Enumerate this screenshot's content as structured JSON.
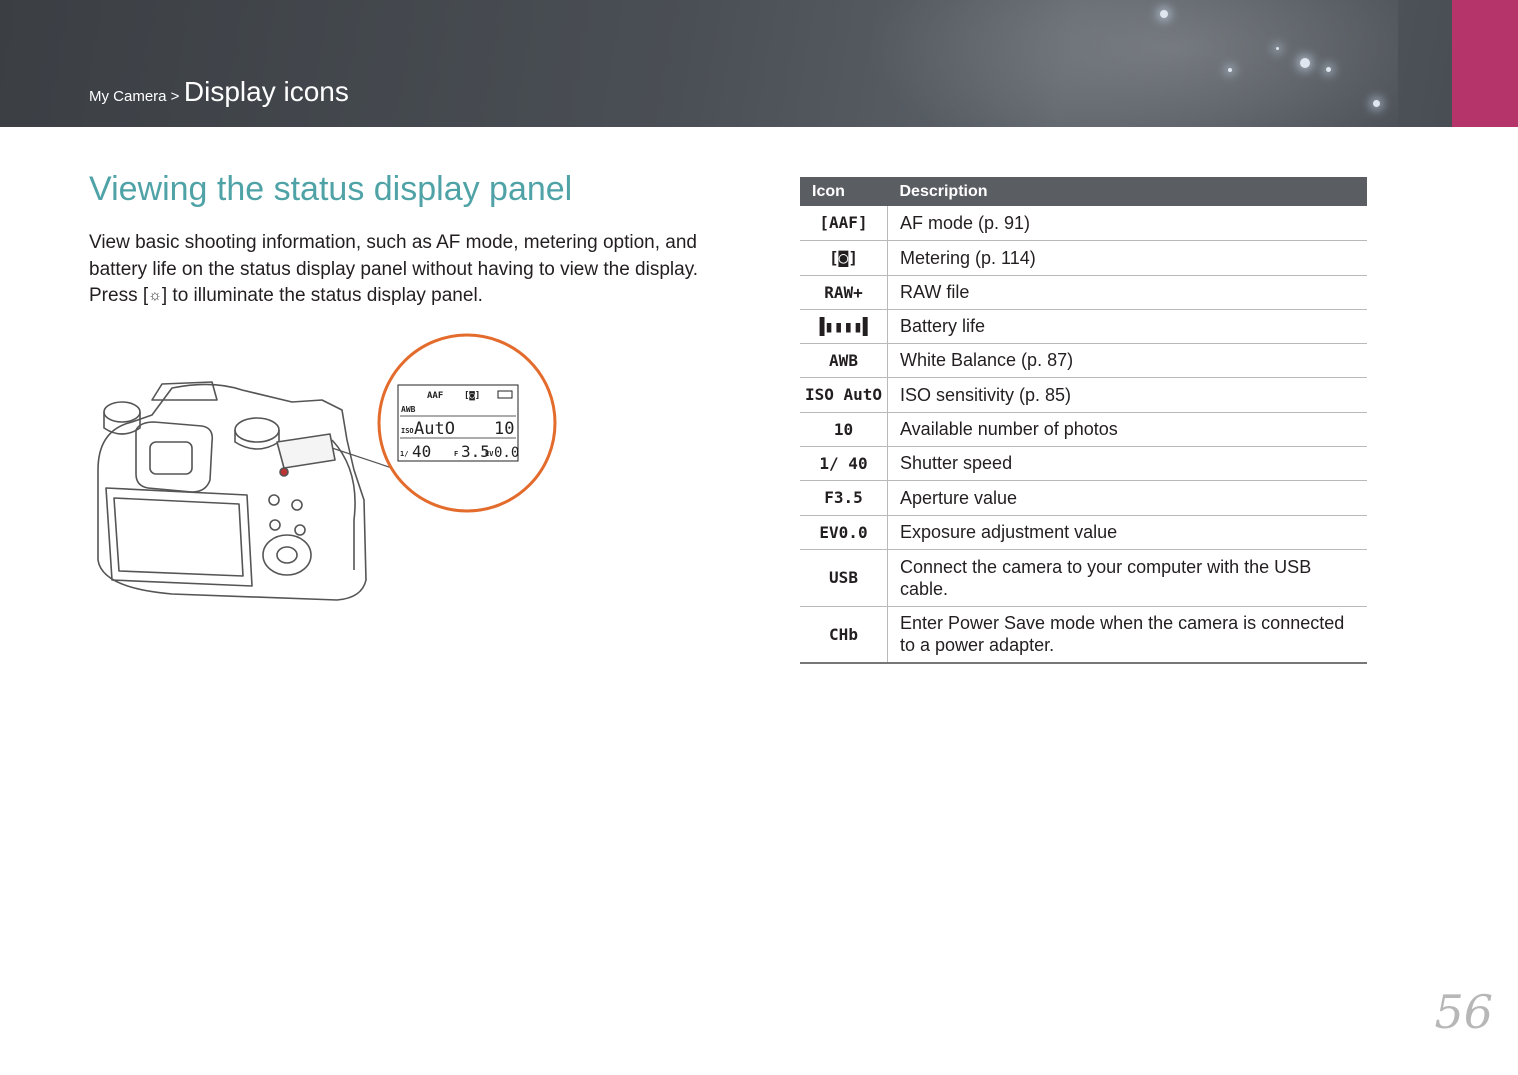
{
  "header": {
    "breadcrumb_parent": "My Camera >",
    "breadcrumb_current": "Display icons"
  },
  "section": {
    "title": "Viewing the status display panel",
    "intro_line1": "View basic shooting information, such as AF mode, metering option, and",
    "intro_line2": "battery life on the status display panel without having to view the display.",
    "intro_press": "Press [",
    "intro_after": "] to illuminate the status display panel."
  },
  "lcd": {
    "af": "AAF",
    "wb": "AWB",
    "iso_label": "ISO",
    "iso_value": "AutO",
    "shots": "10",
    "shutter_prefix": "1/",
    "shutter": "40",
    "aperture_prefix": "F",
    "aperture": "3.5",
    "ev_prefix": "EV",
    "ev": "0.0"
  },
  "table": {
    "col_icon": "Icon",
    "col_desc": "Description",
    "rows": [
      {
        "icon": "[AAF]",
        "icon_name": "af-mode-icon",
        "desc": "AF mode (p. 91)"
      },
      {
        "icon": "[◙]",
        "icon_name": "metering-icon",
        "desc": "Metering (p. 114)"
      },
      {
        "icon": "RAW+",
        "icon_name": "raw-plus-icon",
        "desc": "RAW file"
      },
      {
        "icon": "▐▮▮▮▮▌",
        "icon_name": "battery-icon",
        "desc": "Battery life"
      },
      {
        "icon": "AWB",
        "icon_name": "awb-icon",
        "desc": "White Balance (p. 87)"
      },
      {
        "icon": "ISO AutO",
        "icon_name": "iso-auto-icon",
        "desc": "ISO sensitivity (p. 85)"
      },
      {
        "icon": "10",
        "icon_name": "shots-count-icon",
        "desc": "Available number of photos"
      },
      {
        "icon": "1/ 40",
        "icon_name": "shutter-speed-icon",
        "desc": "Shutter speed"
      },
      {
        "icon": "F3.5",
        "icon_name": "aperture-icon",
        "desc": "Aperture value"
      },
      {
        "icon": "EV0.0",
        "icon_name": "exposure-icon",
        "desc": "Exposure adjustment value"
      },
      {
        "icon": "USB",
        "icon_name": "usb-icon",
        "desc": "Connect the camera to your computer with the USB cable."
      },
      {
        "icon": "CHb",
        "icon_name": "charge-icon",
        "desc": "Enter Power Save mode when the camera is connected to a power adapter."
      }
    ]
  },
  "page_number": "56",
  "colors": {
    "title": "#4fa3a7",
    "header_bg": "#454a50",
    "header_accent": "#b5346a",
    "callout": "#e36b2c",
    "table_header": "#5a5d62"
  }
}
